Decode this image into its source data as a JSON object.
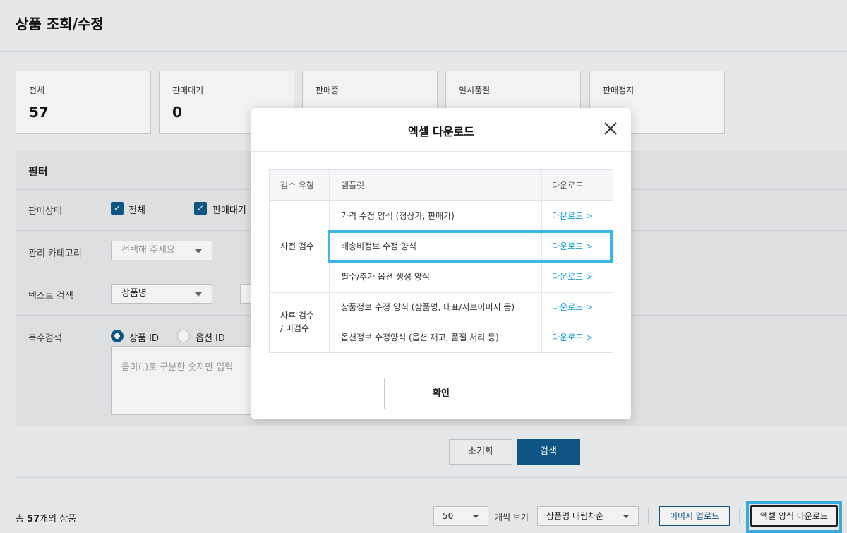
{
  "page": {
    "title": "상품 조회/수정"
  },
  "stats": [
    {
      "label": "전체",
      "value": "57"
    },
    {
      "label": "판매대기",
      "value": "0"
    },
    {
      "label": "판매중",
      "value": ""
    },
    {
      "label": "일시품절",
      "value": ""
    },
    {
      "label": "판매정지",
      "value": ""
    }
  ],
  "filter": {
    "title": "필터",
    "sale_status": {
      "label": "판매상태",
      "options": [
        "전체",
        "판매대기"
      ]
    },
    "category": {
      "label": "관리 카테고리",
      "placeholder": "선택해 주세요"
    },
    "text_search": {
      "label": "텍스트 검색",
      "selected": "상품명"
    },
    "multi_search": {
      "label": "복수검색",
      "radios": [
        "상품 ID",
        "옵션 ID"
      ],
      "placeholder": "콤마(,)로 구분한 숫자만 입력"
    },
    "reset_label": "초기화",
    "search_label": "검색"
  },
  "results_bar": {
    "total_prefix": "총 ",
    "total_count": "57",
    "total_suffix": "개의 상품",
    "per_page": "50",
    "per_page_label": "개씩 보기",
    "sort": "상품명 내림차순",
    "upload_label": "이미지 업로드",
    "excel_download_label": "엑셀 양식 다운로드"
  },
  "modal": {
    "title": "엑셀 다운로드",
    "columns": [
      "검수 유형",
      "템플릿",
      "다운로드"
    ],
    "groups": [
      {
        "type": "사전 검수",
        "type_line2": ""
      },
      {
        "type": "사후 검수",
        "type_line2": "/ 미검수"
      }
    ],
    "rows": [
      {
        "template": "가격 수정 양식 (정상가, 판매가)",
        "download": "다운로드 >"
      },
      {
        "template": "배송비정보 수정 양식",
        "download": "다운로드 >"
      },
      {
        "template": "필수/추가 옵션 생성 양식",
        "download": "다운로드 >"
      },
      {
        "template": "상품정보 수정 양식 (상품명, 대표/서브이미지 등)",
        "download": "다운로드 >"
      },
      {
        "template": "옵션정보 수정양식 (옵션 재고, 품절 처리 등)",
        "download": "다운로드 >"
      }
    ],
    "confirm_label": "확인"
  }
}
